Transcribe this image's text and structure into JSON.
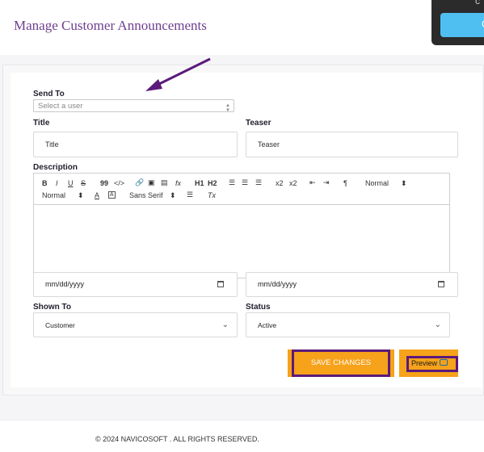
{
  "page": {
    "title": "Manage Customer Announcements"
  },
  "toast": {
    "text": "c",
    "button_label": "C"
  },
  "form": {
    "send_to": {
      "label": "Send To",
      "placeholder": "Select a user"
    },
    "title": {
      "label": "Title",
      "placeholder": "Title"
    },
    "teaser": {
      "label": "Teaser",
      "placeholder": "Teaser"
    },
    "description": {
      "label": "Description",
      "toolbar": {
        "bold": "B",
        "italic": "I",
        "underline": "U",
        "strike": "S",
        "quote": "99",
        "code": "</>",
        "formula": "fx",
        "h1": "H1",
        "h2": "H2",
        "sub": "x2",
        "sup": "x2",
        "direction": "¶",
        "header_select": "Normal",
        "size_select": "Normal",
        "color": "A",
        "background": "A",
        "font_select": "Sans Serif",
        "clean": "Tx"
      }
    },
    "start_date": {
      "value": "mm/dd/yyyy"
    },
    "end_date": {
      "value": "mm/dd/yyyy"
    },
    "shown_to": {
      "label": "Shown To",
      "value": "Customer"
    },
    "status": {
      "label": "Status",
      "value": "Active"
    },
    "save_label": "SAVE CHANGES",
    "preview_label": "Preview"
  },
  "footer": {
    "copyright": "© 2024 NAVICOSOFT . ALL RIGHTS RESERVED."
  },
  "colors": {
    "accent": "#f6a21a",
    "brand_purple": "#6f3e91",
    "outline": "#5b1a7a",
    "toast_button": "#4fbff1"
  }
}
